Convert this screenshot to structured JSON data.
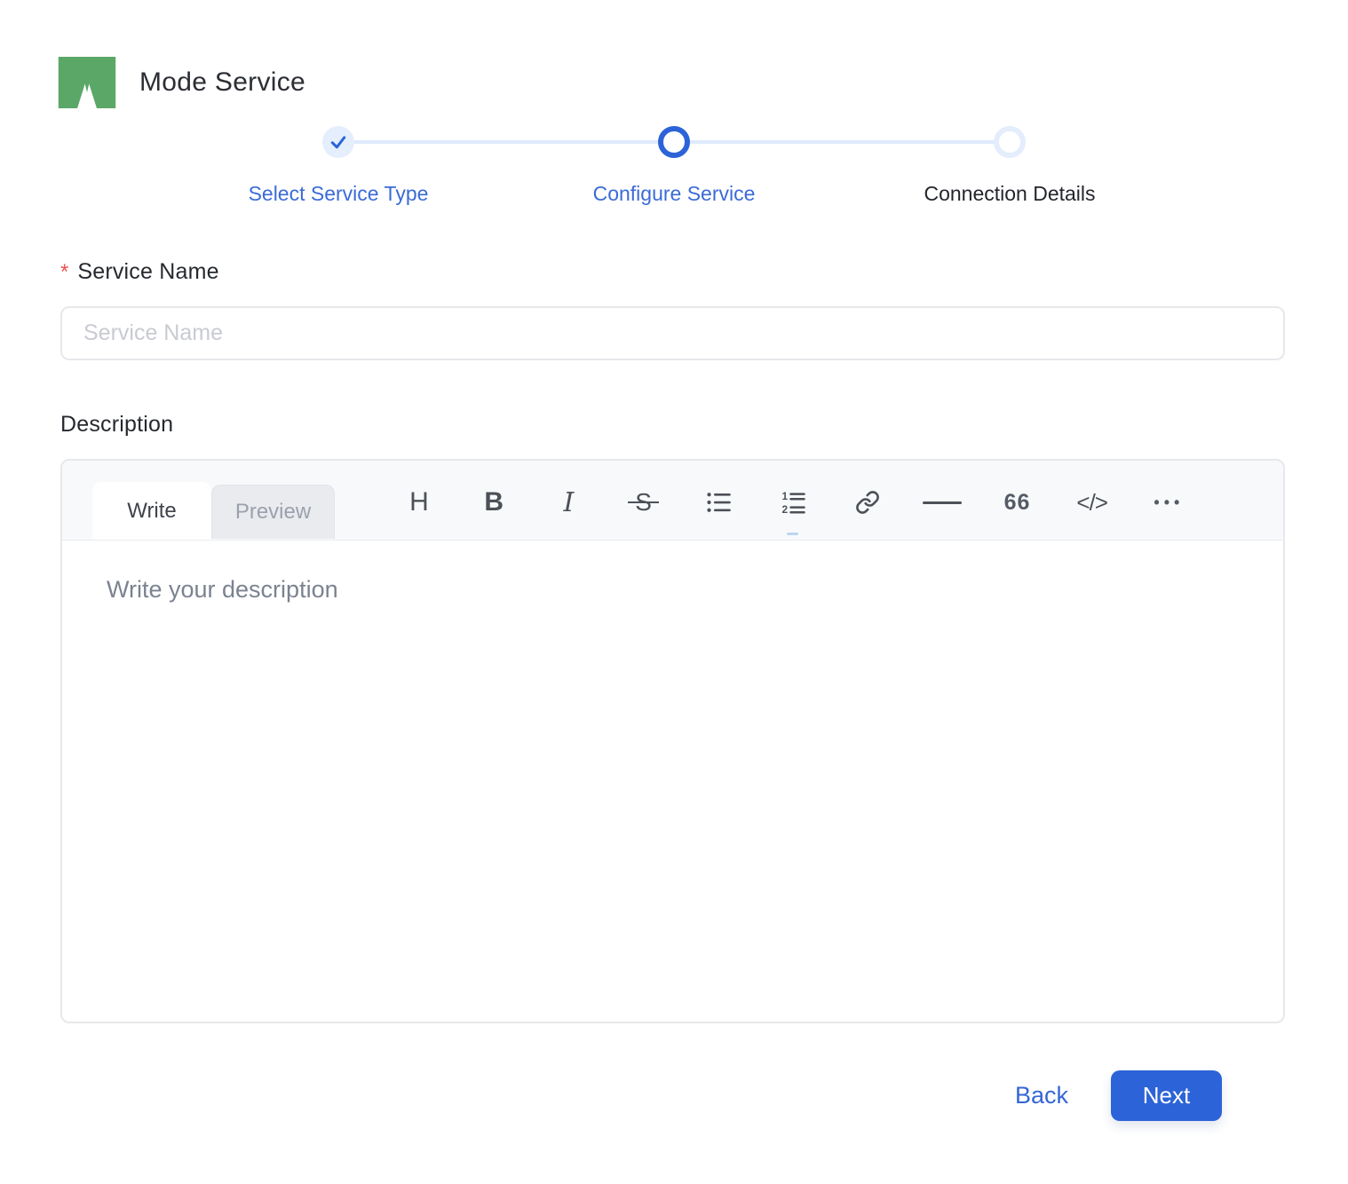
{
  "header": {
    "title": "Mode Service",
    "logo": "mode-m-logo"
  },
  "stepper": {
    "steps": [
      {
        "label": "Select Service Type",
        "state": "completed"
      },
      {
        "label": "Configure Service",
        "state": "active"
      },
      {
        "label": "Connection Details",
        "state": "upcoming"
      }
    ]
  },
  "form": {
    "service_name": {
      "required_marker": "*",
      "label": "Service Name",
      "placeholder": "Service Name",
      "value": ""
    },
    "description": {
      "label": "Description",
      "tabs": [
        {
          "label": "Write",
          "active": true
        },
        {
          "label": "Preview",
          "active": false
        }
      ],
      "toolbar": [
        {
          "name": "heading-tool",
          "glyph": "H"
        },
        {
          "name": "bold-tool",
          "glyph": "B"
        },
        {
          "name": "italic-tool",
          "glyph": "I"
        },
        {
          "name": "strikethrough-tool",
          "glyph": "S"
        },
        {
          "name": "bullet-list-tool"
        },
        {
          "name": "numbered-list-tool"
        },
        {
          "name": "link-tool"
        },
        {
          "name": "horizontal-rule-tool"
        },
        {
          "name": "quote-tool",
          "glyph": "66"
        },
        {
          "name": "code-tool",
          "glyph": "</>"
        },
        {
          "name": "more-tool",
          "glyph": "•••"
        }
      ],
      "placeholder": "Write your description",
      "value": ""
    }
  },
  "footer": {
    "back_label": "Back",
    "next_label": "Next"
  },
  "colors": {
    "accent_blue": "#2c63d8",
    "link_blue": "#3b6bd8",
    "logo_green": "#5ba767",
    "required_red": "#f05252",
    "step_track_blue": "#dfeafc",
    "step_completed_bg": "#e4eefc",
    "border_gray": "#e6e8eb",
    "editor_header_bg": "#f8f9fb"
  }
}
